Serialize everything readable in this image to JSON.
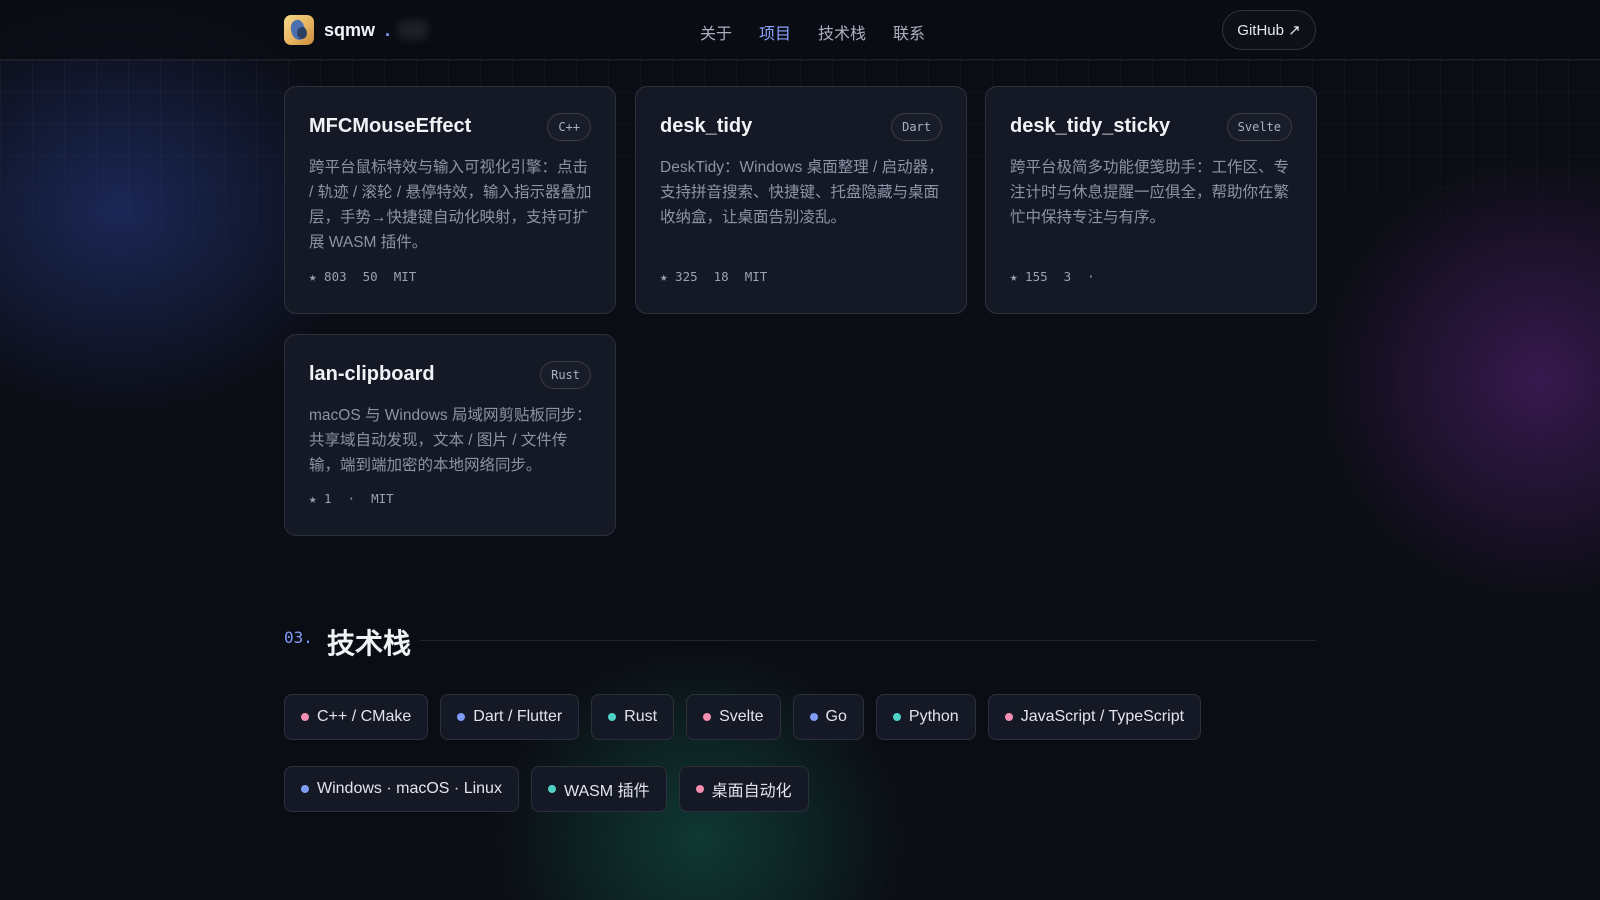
{
  "nav": {
    "brand": "sqmw",
    "brand_dot": ".",
    "links": [
      {
        "label": "关于",
        "active": false
      },
      {
        "label": "项目",
        "active": true
      },
      {
        "label": "技术栈",
        "active": false
      },
      {
        "label": "联系",
        "active": false
      }
    ],
    "github": "GitHub ↗"
  },
  "projects": [
    {
      "name": "MFCMouseEffect",
      "lang": "C++",
      "desc": "跨平台鼠标特效与输入可视化引擎：点击 / 轨迹 / 滚轮 / 悬停特效，输入指示器叠加层，手势→快捷键自动化映射，支持可扩展 WASM 插件。",
      "stars": "★ 803",
      "forks": " 50",
      "license": "MIT"
    },
    {
      "name": "desk_tidy",
      "lang": "Dart",
      "desc": "DeskTidy：Windows 桌面整理 / 启动器，支持拼音搜索、快捷键、托盘隐藏与桌面收纳盒，让桌面告别凌乱。",
      "stars": "★ 325",
      "forks": " 18",
      "license": "MIT"
    },
    {
      "name": "desk_tidy_sticky",
      "lang": "Svelte",
      "desc": "跨平台极简多功能便笺助手：工作区、专注计时与休息提醒一应俱全，帮助你在繁忙中保持专注与有序。",
      "stars": "★ 155",
      "forks": " 3",
      "license": "·"
    },
    {
      "name": "lan-clipboard",
      "lang": "Rust",
      "desc": "macOS 与 Windows 局域网剪贴板同步：共享域自动发现，文本 / 图片 / 文件传输，端到端加密的本地网络同步。",
      "stars": "★ 1",
      "forks": "·",
      "license": "MIT"
    }
  ],
  "section": {
    "number": "03.",
    "title": "技术栈"
  },
  "stack": [
    {
      "label": "C++ / CMake",
      "color": "#f28fb0"
    },
    {
      "label": "Dart / Flutter",
      "color": "#7f9cf5"
    },
    {
      "label": "Rust",
      "color": "#4fd1c5"
    },
    {
      "label": "Svelte",
      "color": "#f28fb0"
    },
    {
      "label": "Go",
      "color": "#7f9cf5"
    },
    {
      "label": "Python",
      "color": "#4fd1c5"
    },
    {
      "label": "JavaScript / TypeScript",
      "color": "#f28fb0"
    },
    {
      "label": "Windows · macOS · Linux",
      "color": "#7f9cf5"
    },
    {
      "label": "WASM 插件",
      "color": "#4fd1c5"
    },
    {
      "label": "桌面自动化",
      "color": "#f28fb0"
    }
  ]
}
